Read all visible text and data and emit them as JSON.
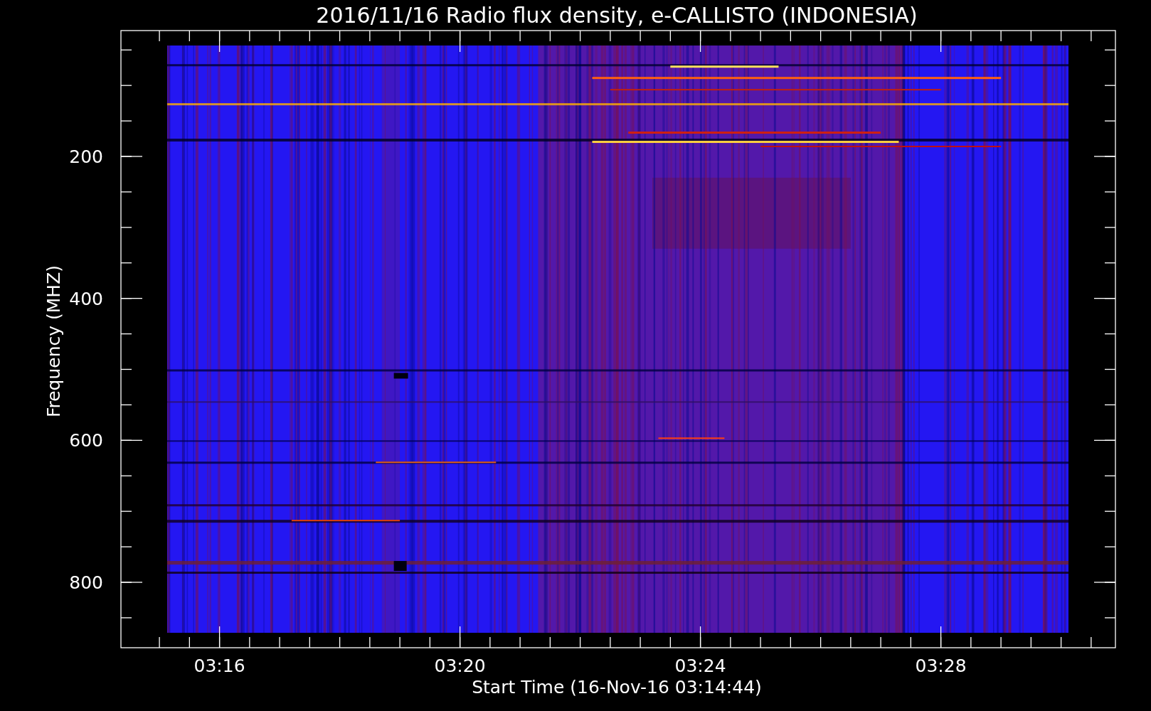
{
  "title": "2016/11/16  Radio flux density, e-CALLISTO (INDONESIA)",
  "y_axis": {
    "label": "Frequency (MHZ)",
    "ticks": [
      "200",
      "400",
      "600",
      "800"
    ]
  },
  "x_axis": {
    "label": "Start Time (16-Nov-16 03:14:44)",
    "ticks": [
      "03:16",
      "03:20",
      "03:24",
      "03:28"
    ]
  }
}
